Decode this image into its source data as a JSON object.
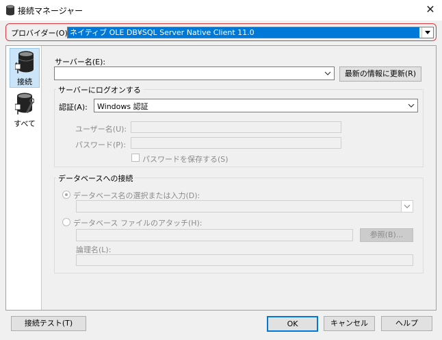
{
  "window": {
    "title": "接続マネージャー",
    "close": "✕"
  },
  "provider": {
    "label": "プロバイダー(O):",
    "value": "ネイティブ OLE DB¥SQL Server Native Client 11.0"
  },
  "sidebar": {
    "items": [
      {
        "label": "接続",
        "icon": "database-plug-icon",
        "selected": true
      },
      {
        "label": "すべて",
        "icon": "database-wrench-icon",
        "selected": false
      }
    ]
  },
  "server": {
    "label": "サーバー名(E):",
    "value": "",
    "refresh_label": "最新の情報に更新(R)"
  },
  "logon": {
    "title": "サーバーにログオンする",
    "auth_label": "認証(A):",
    "auth_value": "Windows 認証",
    "user_label": "ユーザー名(U):",
    "user_value": "",
    "password_label": "パスワード(P):",
    "password_value": "",
    "save_password_label": "パスワードを保存する(S)"
  },
  "database": {
    "title": "データベースへの接続",
    "select_label": "データベース名の選択または入力(D):",
    "select_value": "",
    "attach_label": "データベース ファイルのアタッチ(H):",
    "attach_value": "",
    "browse_label": "参照(B)...",
    "logical_label": "論理名(L):",
    "logical_value": ""
  },
  "footer": {
    "test_label": "接続テスト(T)",
    "ok_label": "OK",
    "cancel_label": "キャンセル",
    "help_label": "ヘルプ"
  },
  "colors": {
    "accent": "#0078d7",
    "highlight_border": "#d9363e",
    "selected_bg": "#cce4f7"
  }
}
